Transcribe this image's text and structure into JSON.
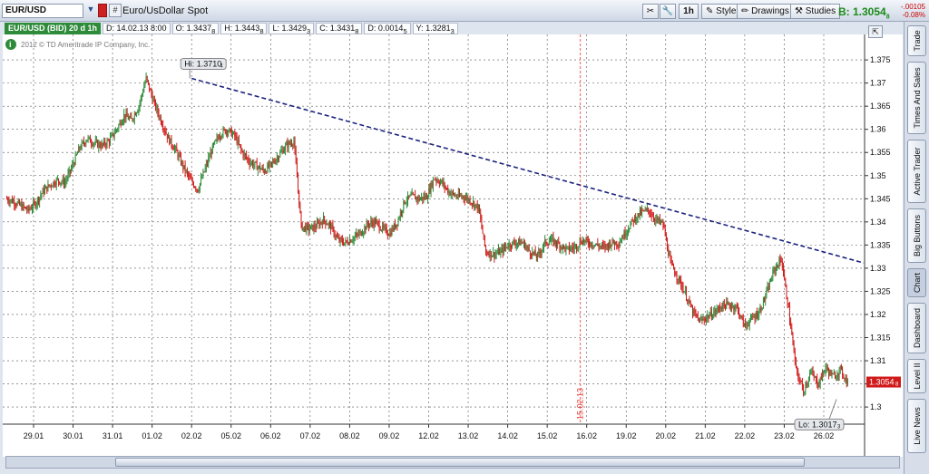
{
  "toolbar": {
    "symbol": "EUR/USD",
    "link_label": "#",
    "description": "Euro/UsDollar Spot",
    "timeframe": "1h",
    "style": "Style",
    "drawings": "Drawings",
    "studies": "Studies",
    "bid": "B: 1.3054",
    "bid_sub": "8",
    "change_abs": "-.00105",
    "change_pct": "-0.08%"
  },
  "infobar": {
    "symbol": "EUR/USD (BID) 20 d 1h",
    "date": "D: 14.02.13 8:00",
    "open": "O: 1.3437",
    "open_sub": "8",
    "high": "H: 1.3443",
    "high_sub": "8",
    "low": "L: 1.3429",
    "low_sub": "3",
    "close": "C: 1.3431",
    "close_sub": "8",
    "delta": "D: 0.0014",
    "delta_sub": "5",
    "y": "Y: 1.3281",
    "y_sub": "3"
  },
  "copyright": "2012 © TD Ameritrade IP Company, Inc.",
  "side_tabs": [
    "Trade",
    "Times And Sales",
    "Active Trader",
    "Big Buttons",
    "Chart",
    "Dashboard",
    "Level II",
    "Live News"
  ],
  "colors": {
    "up": "#2e8b3a",
    "down": "#d11a1a",
    "trend": "#1a237e",
    "marker": "#e53935",
    "grid": "#555555"
  },
  "chart_data": {
    "type": "candlestick",
    "ylim": [
      1.2963,
      1.3805
    ],
    "y_ticks": [
      "1.375",
      "1.37",
      "1.365",
      "1.36",
      "1.355",
      "1.35",
      "1.345",
      "1.34",
      "1.335",
      "1.33",
      "1.325",
      "1.32",
      "1.315",
      "1.31",
      "1.305",
      "1.3"
    ],
    "x_ticks": [
      "29.01",
      "30.01",
      "31.01",
      "01.02",
      "02.02",
      "05.02",
      "06.02",
      "07.02",
      "08.02",
      "09.02",
      "12.02",
      "13.02",
      "14.02",
      "15.02",
      "16.02",
      "19.02",
      "20.02",
      "21.02",
      "22.02",
      "23.02",
      "26.02"
    ],
    "high_label": "Hi: 1.3710",
    "high_label_sub": "4",
    "low_label": "Lo: 1.3017",
    "low_label_sub": "3",
    "last_label": "1.3054",
    "last_label_sub": "8",
    "marker_label": "15.02.13",
    "trendline": {
      "from": [
        "02.02",
        1.371
      ],
      "to": [
        "26.02",
        1.3335
      ]
    },
    "price_path": [
      1.345,
      1.3445,
      1.3435,
      1.3425,
      1.344,
      1.3465,
      1.348,
      1.349,
      1.3485,
      1.352,
      1.356,
      1.358,
      1.357,
      1.3565,
      1.3575,
      1.36,
      1.363,
      1.362,
      1.365,
      1.371,
      1.366,
      1.362,
      1.358,
      1.3555,
      1.352,
      1.349,
      1.347,
      1.3515,
      1.356,
      1.359,
      1.36,
      1.3585,
      1.355,
      1.353,
      1.352,
      1.351,
      1.3525,
      1.3545,
      1.3565,
      1.3575,
      1.339,
      1.3385,
      1.339,
      1.3405,
      1.339,
      1.336,
      1.3355,
      1.3365,
      1.3375,
      1.3395,
      1.34,
      1.3385,
      1.3375,
      1.34,
      1.3445,
      1.3455,
      1.345,
      1.3455,
      1.3495,
      1.3485,
      1.3465,
      1.3455,
      1.3455,
      1.3445,
      1.343,
      1.3335,
      1.333,
      1.3335,
      1.335,
      1.3355,
      1.3355,
      1.3335,
      1.3325,
      1.3355,
      1.336,
      1.335,
      1.334,
      1.3345,
      1.336,
      1.3355,
      1.335,
      1.3345,
      1.3355,
      1.3355,
      1.338,
      1.3405,
      1.342,
      1.3425,
      1.3405,
      1.3395,
      1.331,
      1.328,
      1.3245,
      1.3205,
      1.3185,
      1.3195,
      1.3205,
      1.322,
      1.322,
      1.3215,
      1.3175,
      1.319,
      1.3205,
      1.3245,
      1.3295,
      1.332,
      1.321,
      1.308,
      1.3035,
      1.3075,
      1.305,
      1.3085,
      1.3065,
      1.308,
      1.3054
    ]
  }
}
